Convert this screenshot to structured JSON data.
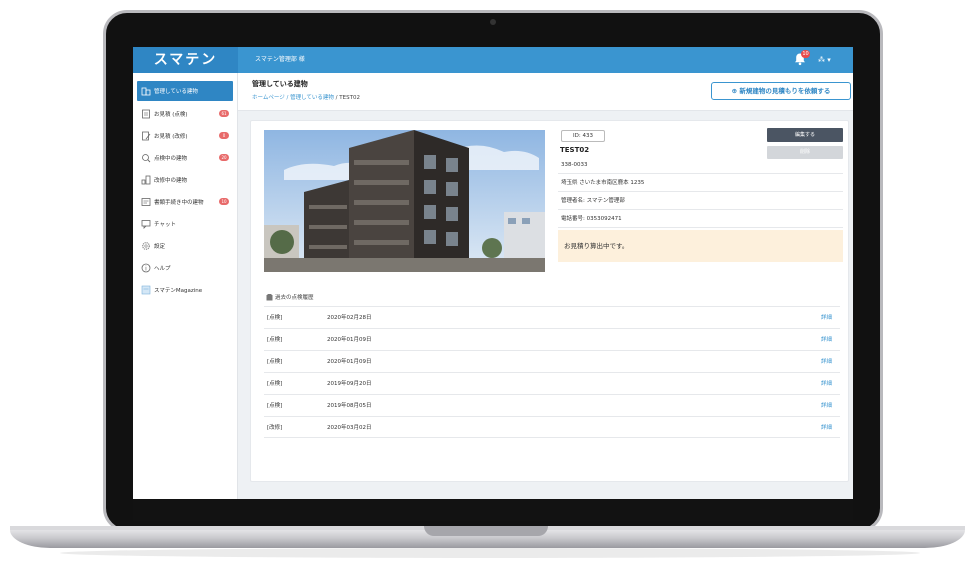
{
  "app": {
    "logo": "スマテン",
    "company": "スマテン管理部 様",
    "notification_count": "10",
    "user_menu": "▾"
  },
  "sidebar": {
    "items": [
      {
        "label": "管理している建物",
        "badge": "",
        "icon": "building-icon"
      },
      {
        "label": "お見積 (点検)",
        "badge": "61",
        "icon": "document-icon"
      },
      {
        "label": "お見積 (改修)",
        "badge": "0",
        "icon": "document-edit-icon"
      },
      {
        "label": "点検中の建物",
        "badge": "20",
        "icon": "inspection-icon"
      },
      {
        "label": "改修中の建物",
        "badge": "",
        "icon": "repair-icon"
      },
      {
        "label": "書類手続き中の建物",
        "badge": "10",
        "icon": "paperwork-icon"
      },
      {
        "label": "チャット",
        "badge": "",
        "icon": "chat-icon"
      },
      {
        "label": "設定",
        "badge": "",
        "icon": "gear-icon"
      },
      {
        "label": "ヘルプ",
        "badge": "",
        "icon": "help-icon"
      },
      {
        "label": "スマテンMagazine",
        "badge": "",
        "icon": "magazine-icon"
      }
    ]
  },
  "header": {
    "title": "管理している建物",
    "breadcrumb": {
      "home": "ホームページ",
      "sep1": " / ",
      "section": "管理している建物",
      "sep2": " / ",
      "current": "TEST02"
    },
    "request_button": "新規建物の見積もりを依頼する"
  },
  "building": {
    "id": "ID: 433",
    "name": "TEST02",
    "postal": "338-0033",
    "address": "埼玉県 さいたま市南区鹿本 1235",
    "manager": "管理者名: スマテン管理部",
    "phone": "電話番号: 0353092471",
    "notice": "お見積り算出中です。",
    "edit_button": "編集する",
    "secondary_button": "削除"
  },
  "history": {
    "title": "過去の点検履歴",
    "rows": [
      {
        "type": "[点検]",
        "date": "2020年02月28日",
        "link": "詳細"
      },
      {
        "type": "[点検]",
        "date": "2020年01月09日",
        "link": "詳細"
      },
      {
        "type": "[点検]",
        "date": "2020年01月09日",
        "link": "詳細"
      },
      {
        "type": "[点検]",
        "date": "2019年09月20日",
        "link": "詳細"
      },
      {
        "type": "[点検]",
        "date": "2019年08月05日",
        "link": "詳細"
      },
      {
        "type": "[改修]",
        "date": "2020年03月02日",
        "link": "詳細"
      }
    ]
  },
  "colors": {
    "brand": "#3a95d0",
    "sidebar_active": "#2f86c4",
    "badge": "#e86a6a",
    "notice_bg": "#fdf0dc",
    "edit_button": "#4b5563"
  }
}
